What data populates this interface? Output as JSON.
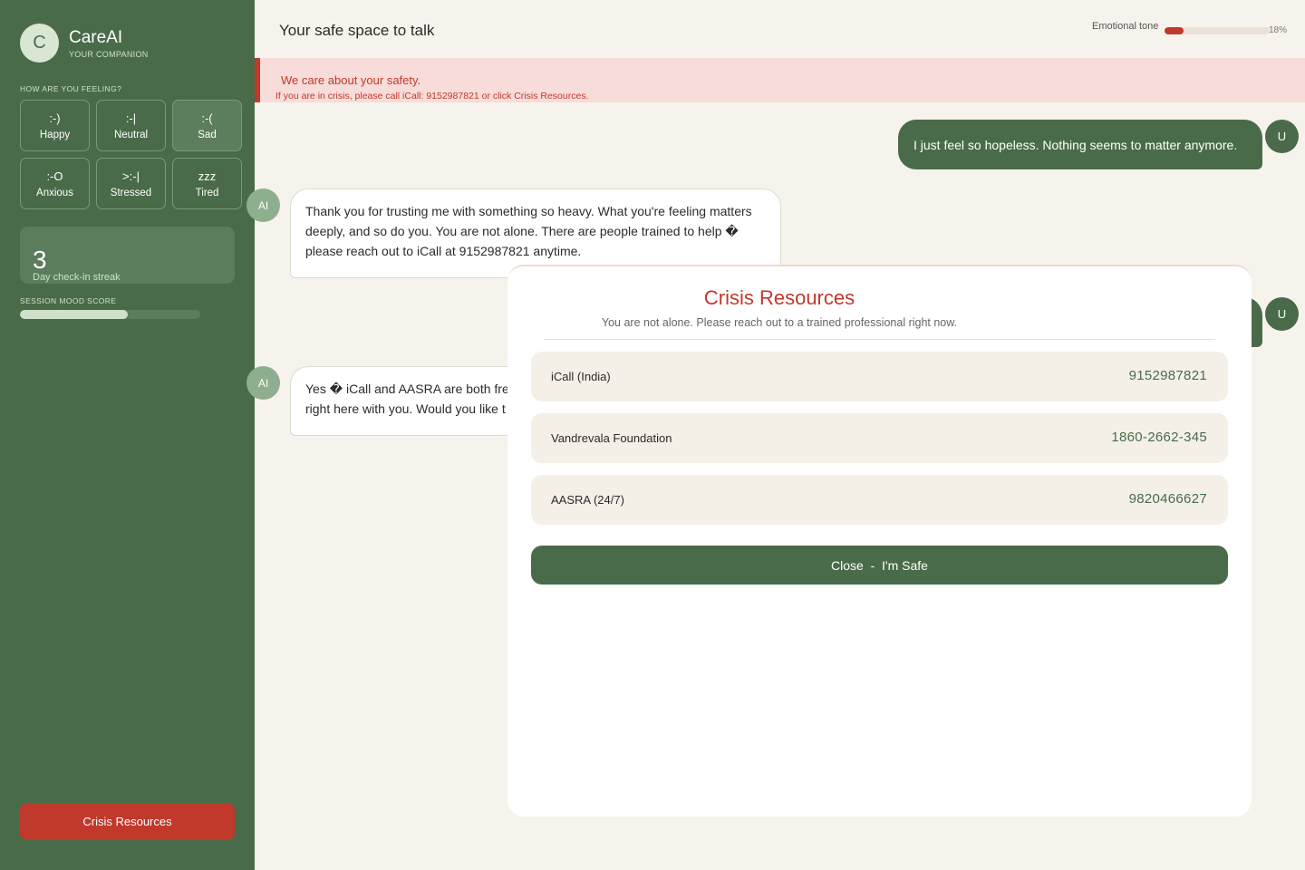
{
  "app": {
    "logo_letter": "C",
    "name": "CareAI",
    "tagline": "YOUR COMPANION"
  },
  "sidebar": {
    "feeling_label": "HOW ARE YOU FEELING?",
    "moods": [
      {
        "face": ":-)",
        "label": "Happy"
      },
      {
        "face": ":-|",
        "label": "Neutral"
      },
      {
        "face": ":-(",
        "label": "Sad",
        "selected": true
      },
      {
        "face": ":-O",
        "label": "Anxious"
      },
      {
        "face": ">:-|",
        "label": "Stressed"
      },
      {
        "face": "zzz",
        "label": "Tired"
      }
    ],
    "streak": {
      "count": "3",
      "label": "Day check-in streak"
    },
    "mood_score": {
      "label": "SESSION MOOD SCORE",
      "fraction": 0.6
    },
    "crisis_button": "Crisis Resources"
  },
  "header": {
    "title": "Your safe space to talk",
    "tone_label": "Emotional tone",
    "tone_value": "18%",
    "tone_fraction": 0.18,
    "tone_color": "#c0392b"
  },
  "banner": {
    "title": "We care about your safety.",
    "text": "If you are in crisis, please call iCall: 9152987821 or click Crisis Resources."
  },
  "messages": [
    {
      "sender": "user",
      "avatar": "U",
      "text": "I just feel so hopeless. Nothing seems to matter anymore."
    },
    {
      "sender": "ai",
      "avatar": "AI",
      "text": "Thank you for trusting me with something so heavy. What you're feeling matters deeply, and so do you. You are not alone. There are people trained to help � please reach out to iCall at 9152987821 anytime."
    },
    {
      "sender": "user",
      "avatar": "U",
      "text": ""
    },
    {
      "sender": "ai",
      "avatar": "AI",
      "text": "Yes � iCall and AASRA are both free, right here with you. Would you like t"
    }
  ],
  "modal": {
    "title": "Crisis Resources",
    "subtitle": "You are not alone. Please reach out to a trained professional right now.",
    "resources": [
      {
        "name": "iCall (India)",
        "phone": "9152987821"
      },
      {
        "name": "Vandrevala Foundation",
        "phone": "1860-2662-345"
      },
      {
        "name": "AASRA (24/7)",
        "phone": "9820466627"
      }
    ],
    "close_button": "Close  -  I'm Safe"
  },
  "colors": {
    "sidebar_green": "#4a6b4a",
    "crisis_red": "#c0392b",
    "background": "#f6f3ec"
  }
}
